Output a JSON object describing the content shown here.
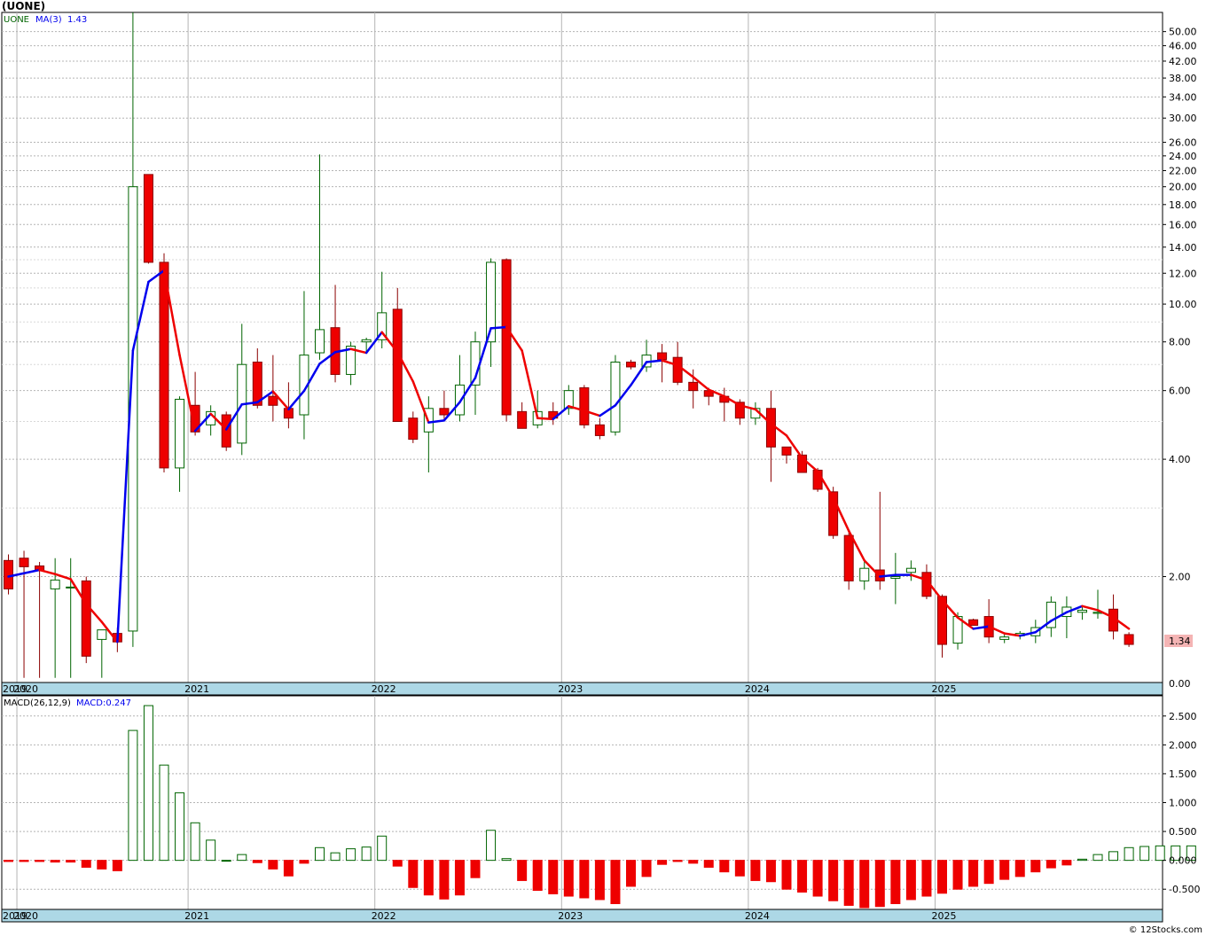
{
  "title": "(UONE)",
  "watermark": "© 12Stocks.com",
  "colors": {
    "up_fill": "#ffffff",
    "up_stroke": "#006400",
    "down_fill": "#ee0000",
    "down_stroke": "#8b0000",
    "ma_up": "#0000ee",
    "ma_down": "#ee0000",
    "axis_band": "#add8e6",
    "grid": "#b4b4b4",
    "last_price_bg": "#f4b4b4",
    "hist_up": "#006400",
    "hist_down": "#ee0000"
  },
  "price_legend": {
    "symbol": "UONE",
    "ma_label": "MA(3)",
    "ma_value": "1.43"
  },
  "macd_legend": {
    "params": "MACD(26,12,9)",
    "value_label": "MACD:0.247"
  },
  "last_price": "1.34",
  "chart_data": [
    {
      "type": "candlestick",
      "scale": "log",
      "ylim": [
        1.07,
        56.0
      ],
      "ytick_labels": [
        "0.00",
        "2.00",
        "4.00",
        "6.00",
        "8.00",
        "10.00",
        "12.00",
        "14.00",
        "16.00",
        "18.00",
        "20.00",
        "22.00",
        "24.00",
        "26.00",
        "30.00",
        "34.00",
        "38.00",
        "42.00",
        "46.00",
        "50.00"
      ],
      "xtick_labels": [
        "2019",
        "2020",
        "2021",
        "2022",
        "2023",
        "2024",
        "2025"
      ],
      "x_month_index": [
        0,
        1,
        12,
        24,
        36,
        48,
        60
      ],
      "grid": true,
      "candles": [
        [
          2.2,
          2.28,
          1.8,
          1.86
        ],
        [
          2.23,
          2.33,
          1.1,
          2.12
        ],
        [
          2.13,
          2.18,
          1.1,
          2.07
        ],
        [
          1.86,
          2.23,
          1.1,
          1.96
        ],
        [
          1.88,
          2.23,
          1.1,
          1.88
        ],
        [
          1.95,
          2.0,
          1.2,
          1.25
        ],
        [
          1.38,
          1.45,
          1.1,
          1.46
        ],
        [
          1.43,
          1.48,
          1.28,
          1.36
        ],
        [
          1.45,
          56.0,
          1.32,
          20.0
        ],
        [
          21.5,
          21.5,
          12.7,
          12.8
        ],
        [
          12.8,
          13.5,
          3.7,
          3.8
        ],
        [
          3.8,
          5.8,
          3.3,
          5.7
        ],
        [
          5.5,
          6.7,
          4.6,
          4.7
        ],
        [
          4.9,
          5.5,
          4.6,
          5.3
        ],
        [
          5.2,
          5.3,
          4.2,
          4.3
        ],
        [
          4.4,
          8.9,
          4.1,
          7.0
        ],
        [
          7.1,
          7.7,
          5.4,
          5.5
        ],
        [
          5.8,
          7.4,
          5.0,
          5.5
        ],
        [
          5.4,
          6.3,
          4.8,
          5.1
        ],
        [
          5.2,
          10.8,
          4.5,
          7.4
        ],
        [
          7.5,
          24.2,
          7.2,
          8.6
        ],
        [
          8.7,
          11.2,
          6.3,
          6.6
        ],
        [
          6.6,
          8.0,
          6.2,
          7.8
        ],
        [
          8.0,
          8.2,
          7.5,
          8.1
        ],
        [
          8.1,
          12.1,
          7.7,
          9.5
        ],
        [
          9.7,
          11.0,
          5.0,
          5.0
        ],
        [
          5.1,
          5.3,
          4.4,
          4.5
        ],
        [
          4.7,
          5.8,
          3.7,
          5.4
        ],
        [
          5.4,
          6.0,
          5.0,
          5.2
        ],
        [
          5.2,
          7.4,
          5.0,
          6.2
        ],
        [
          6.2,
          8.5,
          5.2,
          8.0
        ],
        [
          8.0,
          13.1,
          6.9,
          12.8
        ],
        [
          13.0,
          13.1,
          5.0,
          5.2
        ],
        [
          5.3,
          5.6,
          4.8,
          4.8
        ],
        [
          4.9,
          6.0,
          4.8,
          5.3
        ],
        [
          5.3,
          5.6,
          4.9,
          5.1
        ],
        [
          5.4,
          6.2,
          5.2,
          6.0
        ],
        [
          6.1,
          6.2,
          4.8,
          4.9
        ],
        [
          4.9,
          5.1,
          4.5,
          4.6
        ],
        [
          4.7,
          7.4,
          4.6,
          7.1
        ],
        [
          7.1,
          7.2,
          6.8,
          6.9
        ],
        [
          6.9,
          8.1,
          6.7,
          7.4
        ],
        [
          7.5,
          7.9,
          6.3,
          7.2
        ],
        [
          7.3,
          8.0,
          6.2,
          6.3
        ],
        [
          6.3,
          6.8,
          5.4,
          6.0
        ],
        [
          6.0,
          6.1,
          5.5,
          5.8
        ],
        [
          5.8,
          6.1,
          5.0,
          5.6
        ],
        [
          5.6,
          5.7,
          4.9,
          5.1
        ],
        [
          5.1,
          5.6,
          4.9,
          5.4
        ],
        [
          5.4,
          6.0,
          3.5,
          4.3
        ],
        [
          4.3,
          4.3,
          3.9,
          4.1
        ],
        [
          4.1,
          4.2,
          3.7,
          3.7
        ],
        [
          3.75,
          3.8,
          3.3,
          3.35
        ],
        [
          3.3,
          3.4,
          2.5,
          2.55
        ],
        [
          2.55,
          2.6,
          1.85,
          1.95
        ],
        [
          1.95,
          2.2,
          1.85,
          2.1
        ],
        [
          2.08,
          3.3,
          1.85,
          1.95
        ],
        [
          1.98,
          2.3,
          1.7,
          2.0
        ],
        [
          2.05,
          2.2,
          1.95,
          2.1
        ],
        [
          2.05,
          2.15,
          1.75,
          1.78
        ],
        [
          1.78,
          1.8,
          1.24,
          1.34
        ],
        [
          1.35,
          1.62,
          1.3,
          1.58
        ],
        [
          1.55,
          1.56,
          1.5,
          1.5
        ],
        [
          1.58,
          1.75,
          1.35,
          1.4
        ],
        [
          1.38,
          1.42,
          1.35,
          1.4
        ],
        [
          1.41,
          1.45,
          1.38,
          1.43
        ],
        [
          1.41,
          1.55,
          1.35,
          1.48
        ],
        [
          1.48,
          1.78,
          1.4,
          1.72
        ],
        [
          1.58,
          1.78,
          1.39,
          1.67
        ],
        [
          1.62,
          1.67,
          1.55,
          1.64
        ],
        [
          1.61,
          1.85,
          1.56,
          1.62
        ],
        [
          1.65,
          1.8,
          1.38,
          1.45
        ],
        [
          1.42,
          1.44,
          1.32,
          1.34
        ]
      ],
      "ma3": [
        2.0,
        2.04,
        2.08,
        2.03,
        1.97,
        1.7,
        1.53,
        1.36,
        7.6,
        11.4,
        12.2,
        7.4,
        4.73,
        5.23,
        4.77,
        5.53,
        5.6,
        5.97,
        5.37,
        5.99,
        7.03,
        7.53,
        7.67,
        7.5,
        8.47,
        7.53,
        6.33,
        4.97,
        5.03,
        5.6,
        6.47,
        8.67,
        8.73,
        7.6,
        5.1,
        5.07,
        5.47,
        5.33,
        5.17,
        5.5,
        6.2,
        7.1,
        7.17,
        6.97,
        6.5,
        6.03,
        5.8,
        5.5,
        5.37,
        4.93,
        4.6,
        4.03,
        3.72,
        3.19,
        2.62,
        2.2,
        2.0,
        2.02,
        2.02,
        1.96,
        1.74,
        1.57,
        1.47,
        1.49,
        1.43,
        1.41,
        1.44,
        1.54,
        1.62,
        1.68,
        1.64,
        1.57,
        1.47
      ]
    },
    {
      "type": "bar",
      "title": "MACD(26,12,9)",
      "ylim": [
        -0.85,
        2.85
      ],
      "ytick_labels": [
        "-0.500",
        "0.000",
        "0.500",
        "1.000",
        "1.500",
        "2.000",
        "2.500"
      ],
      "xtick_labels": [
        "2019",
        "2020",
        "2021",
        "2022",
        "2023",
        "2024",
        "2025"
      ],
      "values": [
        -0.02,
        -0.02,
        -0.02,
        -0.03,
        -0.03,
        -0.12,
        -0.15,
        -0.18,
        2.25,
        2.68,
        1.65,
        1.17,
        0.65,
        0.35,
        0.0,
        0.1,
        -0.04,
        -0.15,
        -0.27,
        -0.05,
        0.22,
        0.13,
        0.2,
        0.23,
        0.42,
        -0.1,
        -0.47,
        -0.6,
        -0.67,
        -0.6,
        -0.3,
        0.52,
        0.03,
        -0.35,
        -0.52,
        -0.58,
        -0.62,
        -0.65,
        -0.68,
        -0.75,
        -0.45,
        -0.28,
        -0.07,
        -0.02,
        -0.05,
        -0.12,
        -0.2,
        -0.27,
        -0.35,
        -0.37,
        -0.5,
        -0.55,
        -0.62,
        -0.7,
        -0.78,
        -0.82,
        -0.8,
        -0.75,
        -0.68,
        -0.62,
        -0.57,
        -0.5,
        -0.45,
        -0.4,
        -0.33,
        -0.28,
        -0.2,
        -0.13,
        -0.08,
        0.02,
        0.1,
        0.15,
        0.22,
        0.24,
        0.25,
        0.25,
        0.25
      ]
    }
  ]
}
